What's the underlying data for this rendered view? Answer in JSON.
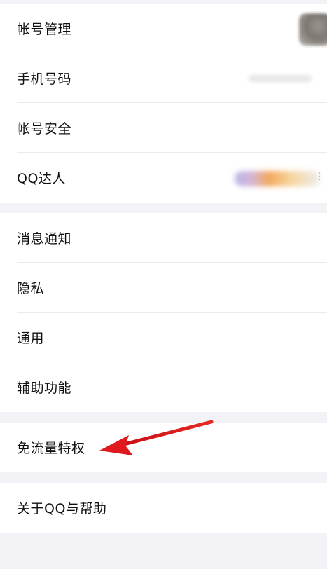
{
  "settings": {
    "account_section": {
      "account_management": "帐号管理",
      "phone_number": "手机号码",
      "account_security": "帐号安全",
      "qq_daren": "QQ达人"
    },
    "general_section": {
      "notifications": "消息通知",
      "privacy": "隐私",
      "general": "通用",
      "accessibility": "辅助功能"
    },
    "traffic_section": {
      "free_data": "免流量特权"
    },
    "about_section": {
      "about_help": "关于QQ与帮助"
    }
  },
  "icons": {
    "kebab": "⋮"
  },
  "colors": {
    "background": "#f2f2f7",
    "arrow": "#e0191e"
  }
}
